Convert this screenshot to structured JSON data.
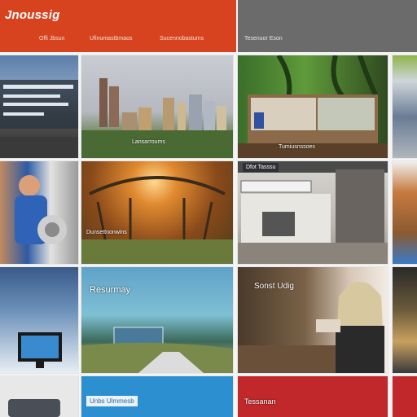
{
  "header": {
    "brand": "Jnoussig",
    "nav": [
      "Offi Jbsun",
      "Ufinumastbmaos",
      "Sucennobastums"
    ],
    "section_label": "Tesenuor Eson"
  },
  "tiles": {
    "r1c1": {
      "caption": ""
    },
    "r1c2": {
      "caption": "Lansarroums"
    },
    "r1c3": {
      "caption": "Tumiusnssoes"
    },
    "r2c2": {
      "caption": "Dunsettnonwins"
    },
    "r2c3": {
      "caption": "Dfot Tasssu"
    },
    "r3c2": {
      "caption": "Resurmay"
    },
    "r3c3": {
      "caption": "Sonst Udig"
    },
    "r4c2": {
      "caption": "Unbs Ulmmesb"
    },
    "r4c3": {
      "caption": "Tessanan"
    }
  },
  "colors": {
    "header_red": "#d8431f",
    "header_gray": "#6b6b6b",
    "tile_blue": "#2b8fd0",
    "tile_red": "#c0282b"
  }
}
